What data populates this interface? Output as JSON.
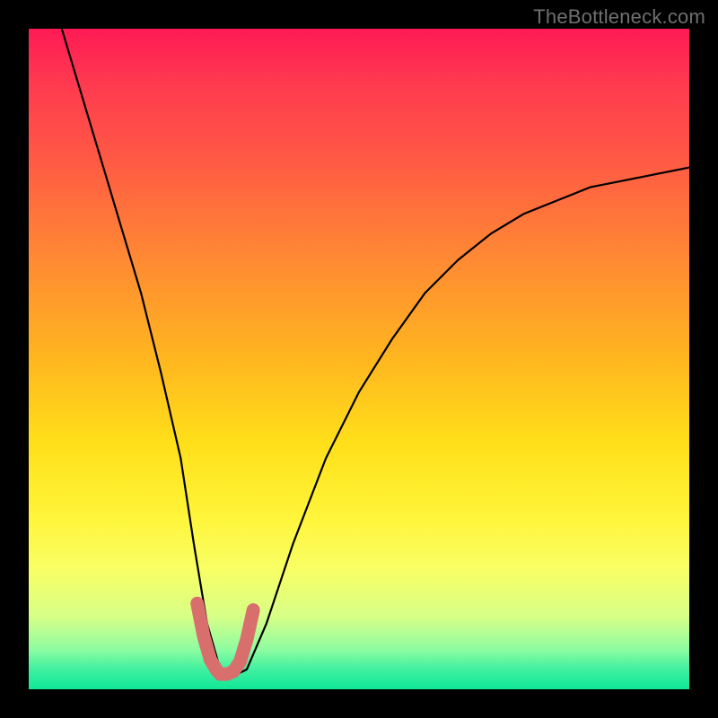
{
  "watermark": "TheBottleneck.com",
  "chart_data": {
    "type": "line",
    "title": "",
    "xlabel": "",
    "ylabel": "",
    "xlim": [
      0,
      100
    ],
    "ylim": [
      0,
      100
    ],
    "grid": false,
    "legend": false,
    "series": [
      {
        "name": "bottleneck-curve",
        "x": [
          5,
          8,
          11,
          14,
          17,
          20,
          23,
          25,
          27,
          29,
          31,
          33,
          36,
          40,
          45,
          50,
          55,
          60,
          65,
          70,
          75,
          80,
          85,
          90,
          95,
          100
        ],
        "y": [
          100,
          90,
          80,
          70,
          60,
          48,
          35,
          22,
          10,
          3,
          2,
          3,
          10,
          22,
          35,
          45,
          53,
          60,
          65,
          69,
          72,
          74,
          76,
          77,
          78,
          79
        ]
      },
      {
        "name": "optimal-range-marker",
        "x": [
          25.5,
          26.5,
          27.5,
          28.5,
          29.0,
          30.0,
          31.0,
          32.0,
          33.0,
          34.0
        ],
        "y": [
          13,
          8,
          4.5,
          2.8,
          2.3,
          2.3,
          2.7,
          4.2,
          7.5,
          12
        ]
      }
    ],
    "annotations": []
  },
  "colors": {
    "curve": "#000000",
    "marker": "#d96f6d",
    "background_top": "#ff1a55",
    "background_bottom": "#10e898"
  }
}
